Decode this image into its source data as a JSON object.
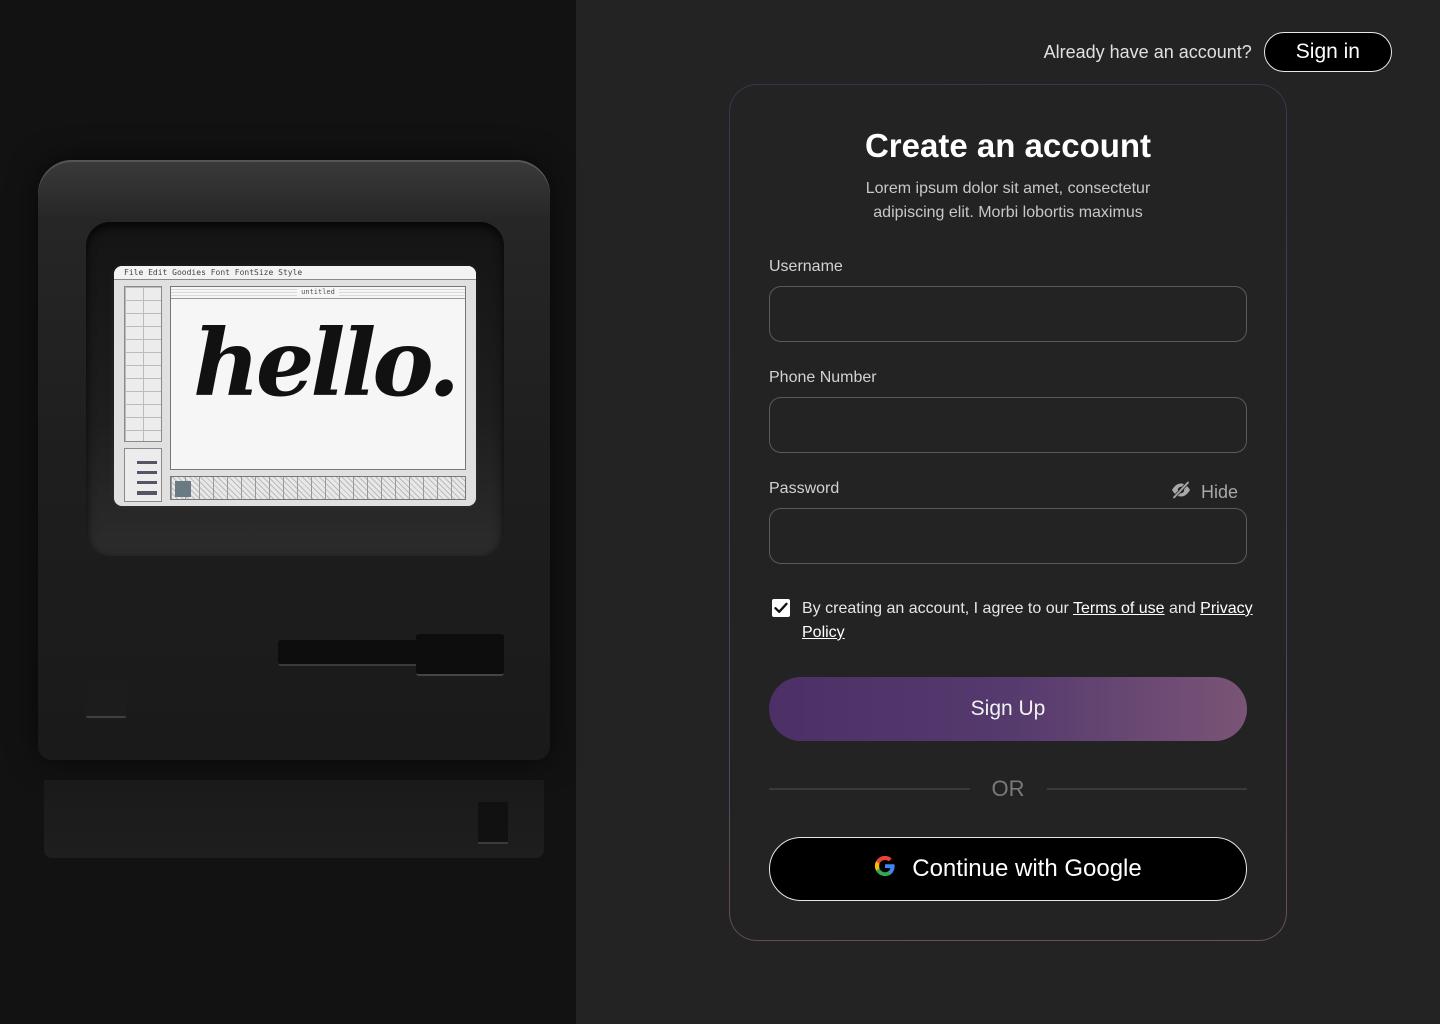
{
  "illustration": {
    "menu_items": "  File  Edit  Goodies  Font  FontSize  Style",
    "window_title": "untitled",
    "canvas_text": "hello."
  },
  "header": {
    "prompt": "Already have an account?",
    "signin_label": "Sign in"
  },
  "form": {
    "title": "Create an account",
    "subtitle": "Lorem ipsum dolor sit amet, consectetur adipiscing elit. Morbi lobortis maximus",
    "fields": {
      "username": {
        "label": "Username",
        "value": ""
      },
      "phone": {
        "label": "Phone Number",
        "value": ""
      },
      "password": {
        "label": "Password",
        "value": ""
      }
    },
    "hide_label": "Hide",
    "terms": {
      "checked": true,
      "prefix": "By creating an account, I agree to our ",
      "terms_link": "Terms of use",
      "middle": " and ",
      "privacy_link": "Privacy Policy"
    },
    "signup_label": "Sign Up",
    "divider_label": "OR",
    "google_label": "Continue with Google"
  },
  "colors": {
    "background": "#232323",
    "left_panel": "#121212",
    "signup_gradient_start": "#4c2f66",
    "signup_gradient_end": "#7a5476"
  },
  "icons": {
    "hide": "eye-slash-icon",
    "checkbox": "checkmark-icon",
    "google": "google-icon"
  }
}
